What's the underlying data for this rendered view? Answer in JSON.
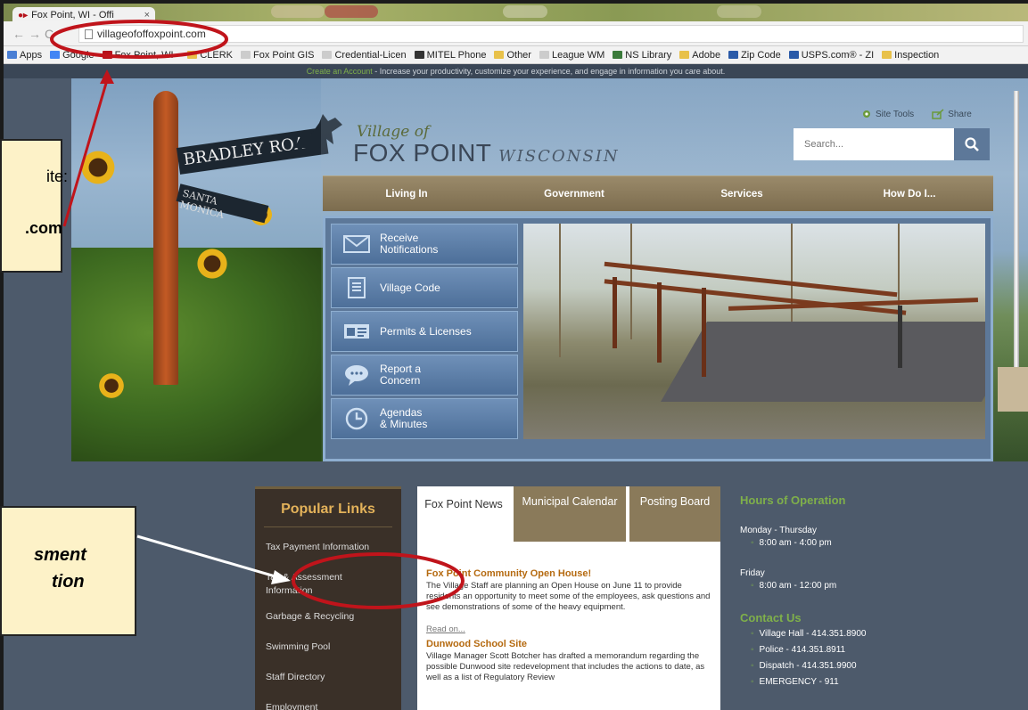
{
  "browser": {
    "tab_title": "Fox Point, WI - Offi",
    "tab_close": "×",
    "url": "villageofoffoxpoint.com",
    "bookmarks": [
      {
        "label": "Apps",
        "icon": "apps-grid-icon",
        "color": "#4a7fd4"
      },
      {
        "label": "Google",
        "icon": "google-icon",
        "color": "#4285f4"
      },
      {
        "label": "Fox Point, WI - ",
        "icon": "foxpoint-favicon",
        "color": "#b5121b"
      },
      {
        "label": "CLERK",
        "icon": "folder-icon",
        "color": "#e8c14a"
      },
      {
        "label": "Fox Point GIS",
        "icon": "page-icon",
        "color": "#cccccc"
      },
      {
        "label": "Credential-Licen",
        "icon": "page-icon",
        "color": "#cccccc"
      },
      {
        "label": "MITEL Phone",
        "icon": "phone-icon",
        "color": "#333333"
      },
      {
        "label": "Other",
        "icon": "folder-icon",
        "color": "#e8c14a"
      },
      {
        "label": "League WM",
        "icon": "page-icon",
        "color": "#cccccc"
      },
      {
        "label": "NS Library",
        "icon": "library-icon",
        "color": "#3a7a3a"
      },
      {
        "label": "Adobe",
        "icon": "folder-icon",
        "color": "#e8c14a"
      },
      {
        "label": "Zip Code",
        "icon": "usps-icon",
        "color": "#2a5aa8"
      },
      {
        "label": "USPS.com® - ZI",
        "icon": "usps-icon",
        "color": "#2a5aa8"
      },
      {
        "label": "Inspection",
        "icon": "folder-icon",
        "color": "#e8c14a"
      }
    ]
  },
  "site": {
    "topstrip": {
      "link": "Create an Account",
      "text": " - Increase your productivity, customize your experience, and engage in information you care about."
    },
    "hero": {
      "sign_main": "BRADLEY ROAD",
      "sign_cross": "SANTA MONICA"
    },
    "logo": {
      "small": "Village of",
      "big": "FOX POINT",
      "state": "WISCONSIN"
    },
    "tools": {
      "site_tools": "Site Tools",
      "share": "Share"
    },
    "search": {
      "placeholder": "Search..."
    },
    "nav": [
      "Living In",
      "Government",
      "Services",
      "How Do I..."
    ],
    "quicklinks": [
      {
        "label1": "Receive",
        "label2": "Notifications",
        "icon": "envelope-icon"
      },
      {
        "label1": "Village Code",
        "label2": "",
        "icon": "document-icon"
      },
      {
        "label1": "Permits & Licenses",
        "label2": "",
        "icon": "permit-card-icon"
      },
      {
        "label1": "Report a",
        "label2": "Concern",
        "icon": "speech-bubble-icon"
      },
      {
        "label1": "Agendas",
        "label2": "& Minutes",
        "icon": "clock-icon"
      }
    ],
    "popular": {
      "title": "Popular Links",
      "items": [
        "Tax Payment Information",
        "Tax & Assessment Information",
        "Garbage & Recycling",
        "Swimming Pool",
        "Staff Directory",
        "Employment"
      ]
    },
    "news": {
      "tabs": [
        "Fox Point News",
        "Municipal Calendar",
        "Posting Board"
      ],
      "items": [
        {
          "title": "Fox Point Community Open House!",
          "body": "The Village Staff are planning an Open House on June 11 to provide residents an opportunity to meet some of the employees, ask questions and see demonstrations of some of the heavy equipment.",
          "link": "Read on..."
        },
        {
          "title": "Dunwood School Site",
          "body": "Village Manager Scott Botcher has drafted a memorandum regarding the possible Dunwood site redevelopment that includes the actions to date, as well as a list of Regulatory Review",
          "link": ""
        }
      ]
    },
    "hours": {
      "title": "Hours of Operation",
      "rows": [
        {
          "day": "Monday - Thursday",
          "time": "8:00 am - 4:00 pm"
        },
        {
          "day": "Friday",
          "time": "8:00 am - 12:00 pm"
        }
      ],
      "contact_title": "Contact Us",
      "contacts": [
        "Village Hall - 414.351.8900",
        "Police - 414.351.8911",
        "Dispatch - 414.351.9900",
        "EMERGENCY - 911"
      ]
    }
  },
  "annotations": {
    "box1_line1": "ite:",
    "box1_line2": ".com",
    "box2_line1": "sment",
    "box2_line2": "tion"
  },
  "colors": {
    "annotation_red": "#c0141b",
    "annotation_box": "#fdf2c8",
    "accent_gold": "#e3b25a",
    "accent_green": "#7fb04a",
    "nav_brown": "#8a7a5a",
    "panel_blue": "#5d7899"
  }
}
